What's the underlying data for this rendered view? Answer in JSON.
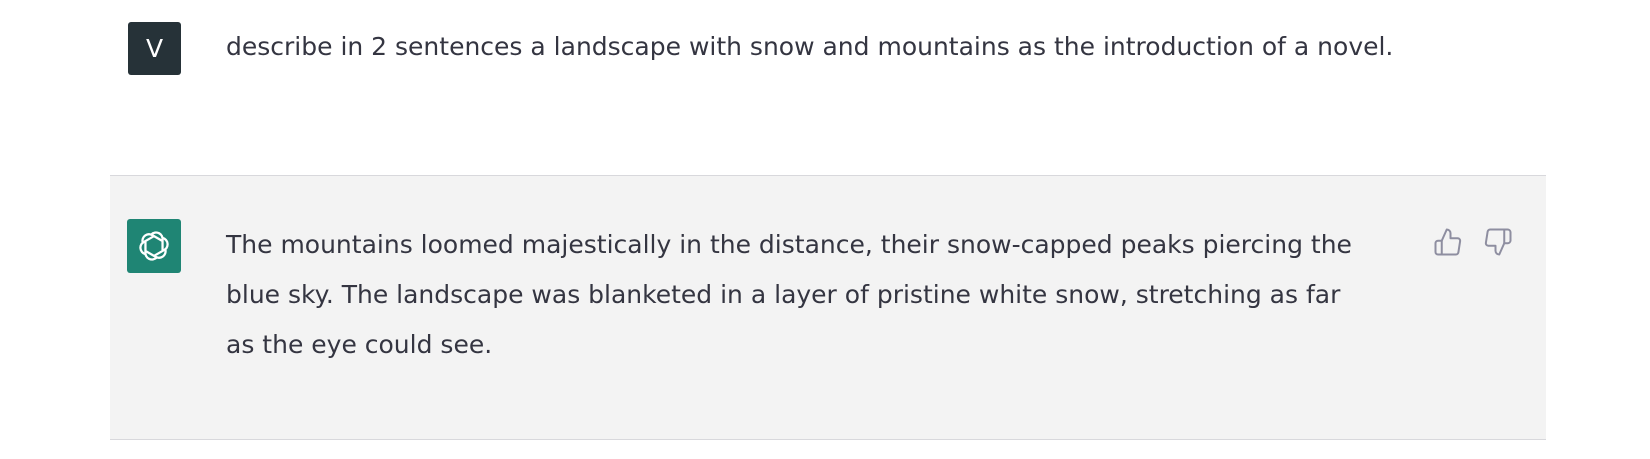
{
  "conversation": {
    "user_message": {
      "avatar_letter": "V",
      "text": "describe in 2 sentences a landscape with snow and mountains as the introduction of a novel."
    },
    "assistant_message": {
      "avatar_icon": "openai-logo-icon",
      "text": "The mountains loomed majestically in the distance, their snow-capped peaks piercing the blue sky. The landscape was blanketed in a layer of pristine white snow, stretching as far as the eye could see."
    },
    "feedback": {
      "thumbs_up_icon": "thumbs-up-icon",
      "thumbs_down_icon": "thumbs-down-icon"
    }
  },
  "colors": {
    "user_avatar_bg": "#263238",
    "assistant_avatar_bg": "#1f8574",
    "assistant_row_bg": "#f3f3f3",
    "text": "#343541",
    "icon": "#8e8ea0"
  }
}
